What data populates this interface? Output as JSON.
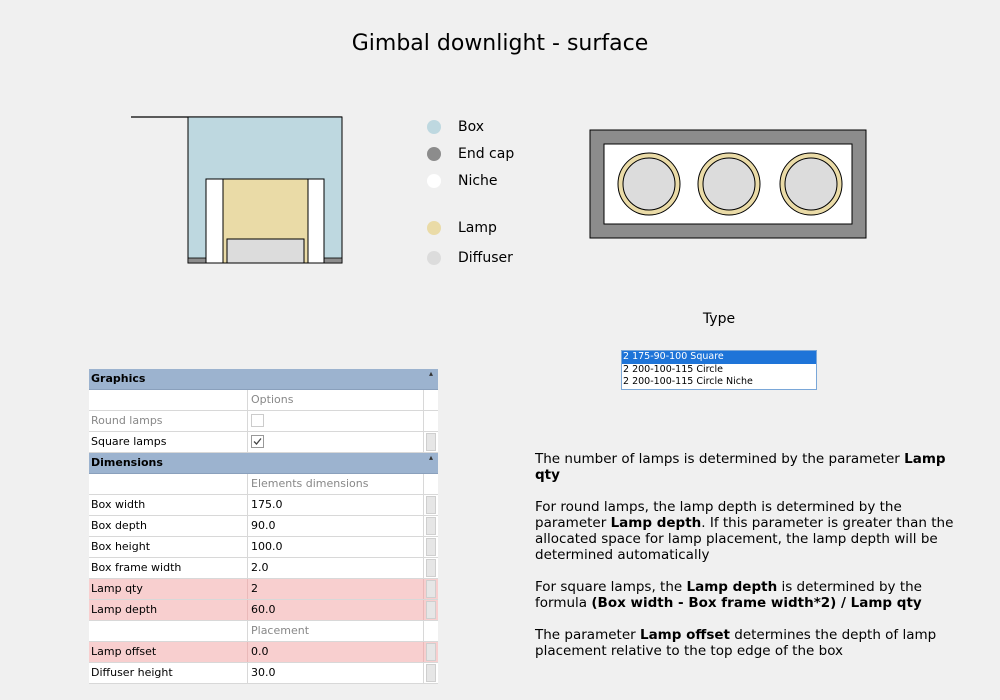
{
  "title": "Gimbal downlight - surface",
  "legend": [
    {
      "label": "Box",
      "color": "#bed8e0"
    },
    {
      "label": "End cap",
      "color": "#8c8c8c"
    },
    {
      "label": "Niche",
      "color": "#ffffff"
    },
    {
      "label": "Lamp",
      "color": "#eadba7"
    },
    {
      "label": "Diffuser",
      "color": "#dcdcdc"
    }
  ],
  "type": {
    "label": "Type",
    "options": [
      {
        "label": "2 175-90-100 Square",
        "selected": true
      },
      {
        "label": "2 200-100-115 Circle",
        "selected": false
      },
      {
        "label": "2 200-100-115 Circle Niche",
        "selected": false
      }
    ]
  },
  "grid": {
    "graphics": {
      "header": "Graphics",
      "subheader": "Options",
      "round_lamps": {
        "label": "Round lamps",
        "checked": false
      },
      "square_lamps": {
        "label": "Square lamps",
        "checked": true
      }
    },
    "dimensions": {
      "header": "Dimensions",
      "subheader": "Elements dimensions",
      "box_width": {
        "label": "Box width",
        "value": "175.0"
      },
      "box_depth": {
        "label": "Box depth",
        "value": "90.0"
      },
      "box_height": {
        "label": "Box height",
        "value": "100.0"
      },
      "box_frame_width": {
        "label": "Box frame width",
        "value": "2.0"
      },
      "lamp_qty": {
        "label": "Lamp qty",
        "value": "2"
      },
      "lamp_depth": {
        "label": "Lamp depth",
        "value": "60.0"
      },
      "placement": "Placement",
      "lamp_offset": {
        "label": "Lamp offset",
        "value": "0.0"
      },
      "diffuser_height": {
        "label": "Diffuser height",
        "value": "30.0"
      }
    }
  },
  "description": {
    "p1_a": "The number of lamps is determined by the parameter ",
    "p1_b": "Lamp qty",
    "p2_a": "For round lamps, the lamp depth is determined by the parameter ",
    "p2_b": "Lamp depth",
    "p2_c": ". If this parameter is greater than the allocated space for lamp placement, the lamp depth will be determined automatically",
    "p3_a": "For square lamps, the ",
    "p3_b": "Lamp depth",
    "p3_c": " is determined by the formula ",
    "p3_d": "(Box width - Box frame width*2) / Lamp qty",
    "p4_a": "The parameter ",
    "p4_b": "Lamp offset",
    "p4_c": " determines the depth of lamp placement relative to the top edge of the box"
  }
}
